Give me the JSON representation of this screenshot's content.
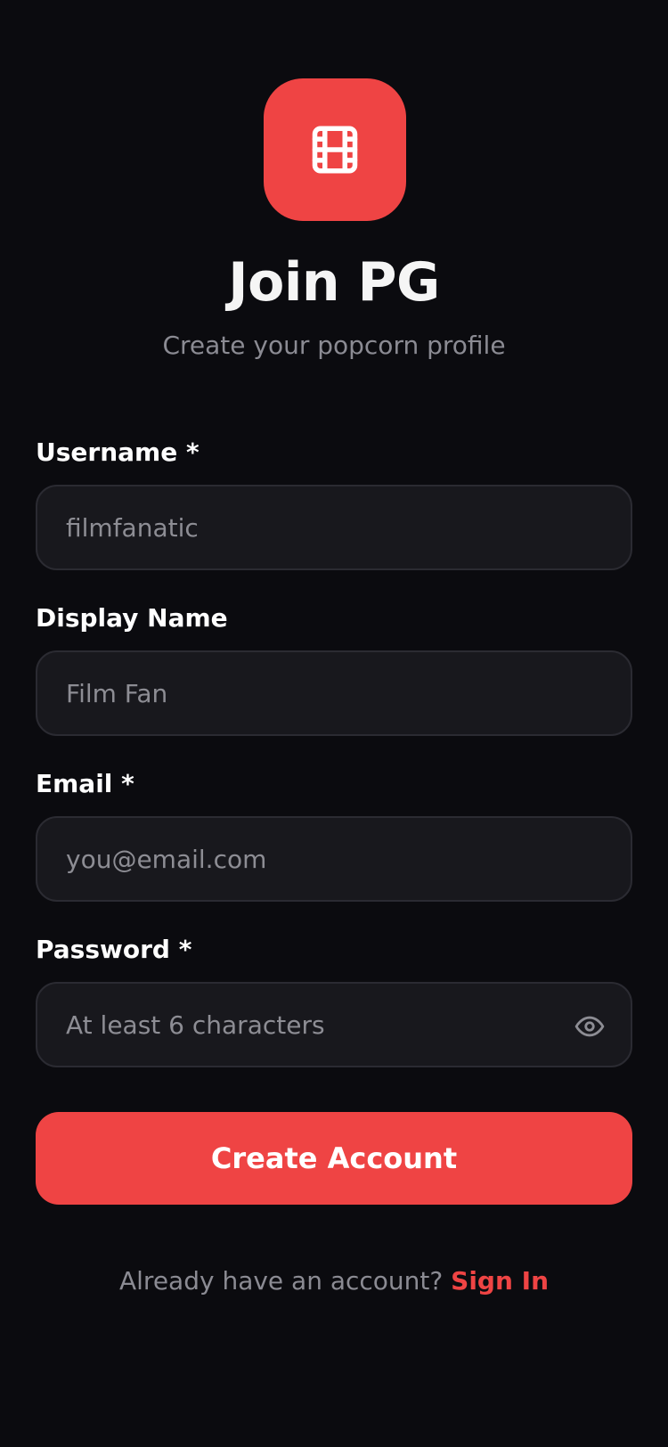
{
  "app": {
    "title": "Join PG",
    "subtitle": "Create your popcorn profile",
    "logo_icon": "film-icon",
    "accent_color": "#ef4444"
  },
  "form": {
    "username": {
      "label": "Username *",
      "placeholder": "filmfanatic",
      "value": ""
    },
    "display_name": {
      "label": "Display Name",
      "placeholder": "Film Fan",
      "value": ""
    },
    "email": {
      "label": "Email *",
      "placeholder": "you@email.com",
      "value": ""
    },
    "password": {
      "label": "Password *",
      "placeholder": "At least 6 characters",
      "value": "",
      "toggle_icon": "eye-icon"
    },
    "submit_label": "Create Account"
  },
  "footer": {
    "prompt": "Already have an account?",
    "link_label": "Sign In"
  }
}
